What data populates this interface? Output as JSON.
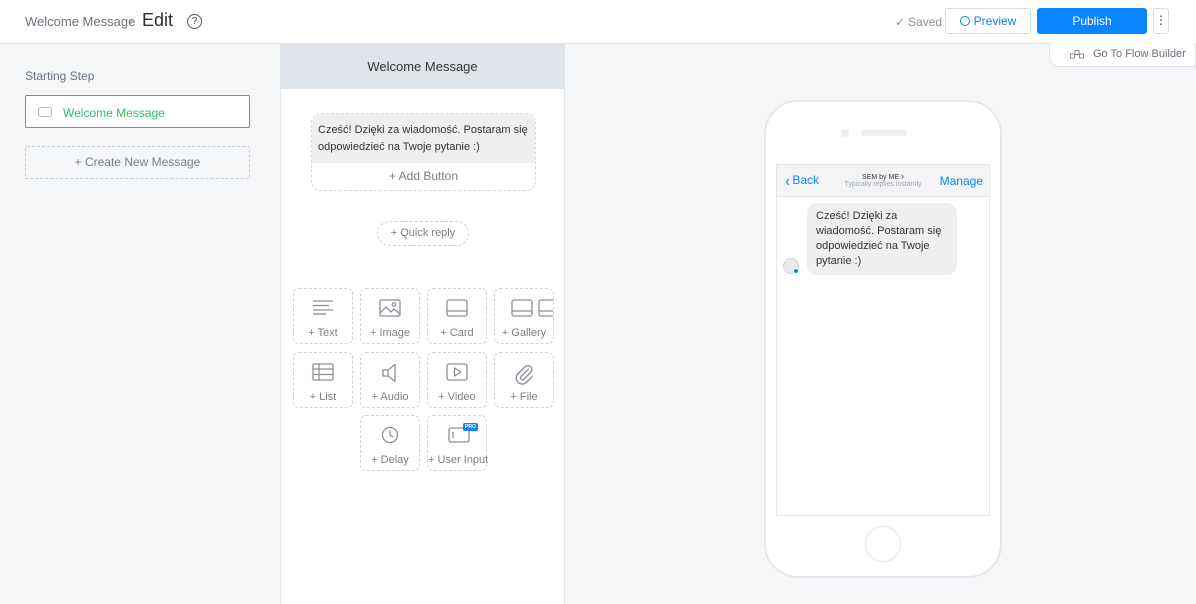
{
  "header": {
    "breadcrumb": "Welcome Message",
    "breadcrumb_separator": "›",
    "title": "Edit",
    "help": "?",
    "saved_label": "Saved",
    "saved_icon": "✓",
    "preview_label": "Preview",
    "publish_label": "Publish",
    "more_label": "⋮",
    "flow_builder_label": "Go To Flow Builder"
  },
  "sidebar": {
    "starting_step_label": "Starting Step",
    "step_name": "Welcome Message",
    "create_new_label": "+ Create New Message"
  },
  "editor": {
    "title": "Welcome Message",
    "message_text": "Cześć! Dzięki za wiadomość. Postaram się odpowiedzieć na Twoje pytanie :)",
    "add_button_label": "+ Add Button",
    "quick_reply_label": "+ Quick reply",
    "tiles": [
      {
        "label": "+ Text",
        "icon": "text-lines-icon"
      },
      {
        "label": "+ Image",
        "icon": "image-icon"
      },
      {
        "label": "+ Card",
        "icon": "card-icon"
      },
      {
        "label": "+ Gallery",
        "icon": "gallery-icon"
      },
      {
        "label": "+ List",
        "icon": "list-icon"
      },
      {
        "label": "+ Audio",
        "icon": "speaker-icon"
      },
      {
        "label": "+ Video",
        "icon": "video-play-icon"
      },
      {
        "label": "+ File",
        "icon": "paperclip-icon"
      },
      {
        "label": "+ Delay",
        "icon": "clock-icon"
      },
      {
        "label": "+ User Input",
        "icon": "user-input-icon",
        "badge": "PRO"
      }
    ]
  },
  "phone_preview": {
    "back_label": "Back",
    "page_name": "SEM by ME",
    "page_name_chevron": "›",
    "page_status": "Typically replies instantly",
    "manage_label": "Manage",
    "bot_message": "Cześć! Dzięki za wiadomość. Postaram się odpowiedzieć na Twoje pytanie :)"
  },
  "colors": {
    "accent_blue": "#0a84ff",
    "success_green": "#2dbf64",
    "editor_header": "#dfe4ea"
  }
}
